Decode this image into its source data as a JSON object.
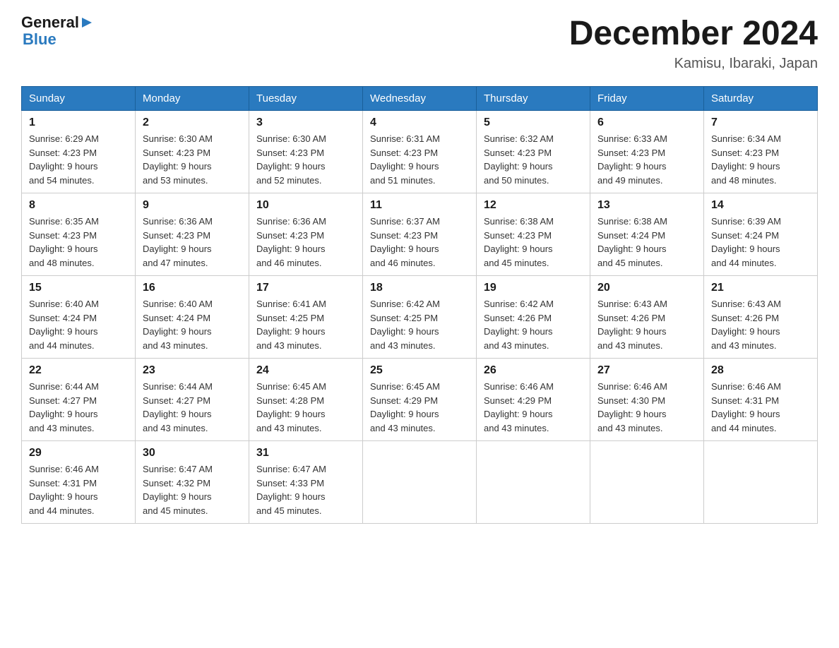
{
  "header": {
    "logo_general": "General",
    "logo_blue": "Blue",
    "month_title": "December 2024",
    "location": "Kamisu, Ibaraki, Japan"
  },
  "days_of_week": [
    "Sunday",
    "Monday",
    "Tuesday",
    "Wednesday",
    "Thursday",
    "Friday",
    "Saturday"
  ],
  "weeks": [
    [
      {
        "day": "1",
        "sunrise": "6:29 AM",
        "sunset": "4:23 PM",
        "daylight": "9 hours and 54 minutes."
      },
      {
        "day": "2",
        "sunrise": "6:30 AM",
        "sunset": "4:23 PM",
        "daylight": "9 hours and 53 minutes."
      },
      {
        "day": "3",
        "sunrise": "6:30 AM",
        "sunset": "4:23 PM",
        "daylight": "9 hours and 52 minutes."
      },
      {
        "day": "4",
        "sunrise": "6:31 AM",
        "sunset": "4:23 PM",
        "daylight": "9 hours and 51 minutes."
      },
      {
        "day": "5",
        "sunrise": "6:32 AM",
        "sunset": "4:23 PM",
        "daylight": "9 hours and 50 minutes."
      },
      {
        "day": "6",
        "sunrise": "6:33 AM",
        "sunset": "4:23 PM",
        "daylight": "9 hours and 49 minutes."
      },
      {
        "day": "7",
        "sunrise": "6:34 AM",
        "sunset": "4:23 PM",
        "daylight": "9 hours and 48 minutes."
      }
    ],
    [
      {
        "day": "8",
        "sunrise": "6:35 AM",
        "sunset": "4:23 PM",
        "daylight": "9 hours and 48 minutes."
      },
      {
        "day": "9",
        "sunrise": "6:36 AM",
        "sunset": "4:23 PM",
        "daylight": "9 hours and 47 minutes."
      },
      {
        "day": "10",
        "sunrise": "6:36 AM",
        "sunset": "4:23 PM",
        "daylight": "9 hours and 46 minutes."
      },
      {
        "day": "11",
        "sunrise": "6:37 AM",
        "sunset": "4:23 PM",
        "daylight": "9 hours and 46 minutes."
      },
      {
        "day": "12",
        "sunrise": "6:38 AM",
        "sunset": "4:23 PM",
        "daylight": "9 hours and 45 minutes."
      },
      {
        "day": "13",
        "sunrise": "6:38 AM",
        "sunset": "4:24 PM",
        "daylight": "9 hours and 45 minutes."
      },
      {
        "day": "14",
        "sunrise": "6:39 AM",
        "sunset": "4:24 PM",
        "daylight": "9 hours and 44 minutes."
      }
    ],
    [
      {
        "day": "15",
        "sunrise": "6:40 AM",
        "sunset": "4:24 PM",
        "daylight": "9 hours and 44 minutes."
      },
      {
        "day": "16",
        "sunrise": "6:40 AM",
        "sunset": "4:24 PM",
        "daylight": "9 hours and 43 minutes."
      },
      {
        "day": "17",
        "sunrise": "6:41 AM",
        "sunset": "4:25 PM",
        "daylight": "9 hours and 43 minutes."
      },
      {
        "day": "18",
        "sunrise": "6:42 AM",
        "sunset": "4:25 PM",
        "daylight": "9 hours and 43 minutes."
      },
      {
        "day": "19",
        "sunrise": "6:42 AM",
        "sunset": "4:26 PM",
        "daylight": "9 hours and 43 minutes."
      },
      {
        "day": "20",
        "sunrise": "6:43 AM",
        "sunset": "4:26 PM",
        "daylight": "9 hours and 43 minutes."
      },
      {
        "day": "21",
        "sunrise": "6:43 AM",
        "sunset": "4:26 PM",
        "daylight": "9 hours and 43 minutes."
      }
    ],
    [
      {
        "day": "22",
        "sunrise": "6:44 AM",
        "sunset": "4:27 PM",
        "daylight": "9 hours and 43 minutes."
      },
      {
        "day": "23",
        "sunrise": "6:44 AM",
        "sunset": "4:27 PM",
        "daylight": "9 hours and 43 minutes."
      },
      {
        "day": "24",
        "sunrise": "6:45 AM",
        "sunset": "4:28 PM",
        "daylight": "9 hours and 43 minutes."
      },
      {
        "day": "25",
        "sunrise": "6:45 AM",
        "sunset": "4:29 PM",
        "daylight": "9 hours and 43 minutes."
      },
      {
        "day": "26",
        "sunrise": "6:46 AM",
        "sunset": "4:29 PM",
        "daylight": "9 hours and 43 minutes."
      },
      {
        "day": "27",
        "sunrise": "6:46 AM",
        "sunset": "4:30 PM",
        "daylight": "9 hours and 43 minutes."
      },
      {
        "day": "28",
        "sunrise": "6:46 AM",
        "sunset": "4:31 PM",
        "daylight": "9 hours and 44 minutes."
      }
    ],
    [
      {
        "day": "29",
        "sunrise": "6:46 AM",
        "sunset": "4:31 PM",
        "daylight": "9 hours and 44 minutes."
      },
      {
        "day": "30",
        "sunrise": "6:47 AM",
        "sunset": "4:32 PM",
        "daylight": "9 hours and 45 minutes."
      },
      {
        "day": "31",
        "sunrise": "6:47 AM",
        "sunset": "4:33 PM",
        "daylight": "9 hours and 45 minutes."
      },
      null,
      null,
      null,
      null
    ]
  ],
  "labels": {
    "sunrise": "Sunrise:",
    "sunset": "Sunset:",
    "daylight": "Daylight:"
  }
}
